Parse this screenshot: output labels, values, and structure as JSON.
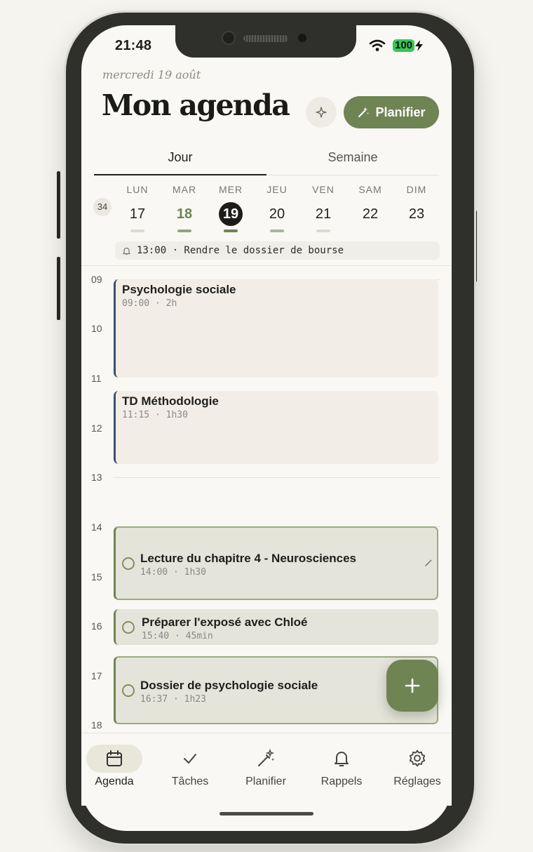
{
  "status": {
    "time": "21:48",
    "battery": "100"
  },
  "header": {
    "date": "mercredi 19 août",
    "title": "Mon agenda",
    "plan_label": "Planifier"
  },
  "tabs": [
    {
      "label": "Jour",
      "active": true
    },
    {
      "label": "Semaine",
      "active": false
    }
  ],
  "week": {
    "number": "34",
    "days": [
      {
        "name": "LUN",
        "num": "17"
      },
      {
        "name": "MAR",
        "num": "18"
      },
      {
        "name": "MER",
        "num": "19"
      },
      {
        "name": "JEU",
        "num": "20"
      },
      {
        "name": "VEN",
        "num": "21"
      },
      {
        "name": "SAM",
        "num": "22"
      },
      {
        "name": "DIM",
        "num": "23"
      }
    ]
  },
  "reminder": {
    "text": "13:00 · Rendre le dossier de bourse"
  },
  "hours": [
    "09",
    "10",
    "11",
    "12",
    "13",
    "14",
    "15",
    "16",
    "17",
    "18"
  ],
  "events": [
    {
      "title": "Psychologie sociale",
      "meta": "09:00 · 2h"
    },
    {
      "title": "TD Méthodologie",
      "meta": "11:15 · 1h30"
    },
    {
      "title": "Lecture du chapitre 4 - Neurosciences",
      "meta": "14:00 · 1h30"
    },
    {
      "title": "Préparer l'exposé avec Chloé",
      "meta": "15:40 · 45min"
    },
    {
      "title": "Dossier de psychologie sociale",
      "meta": "16:37 · 1h23"
    }
  ],
  "nav": [
    {
      "label": "Agenda",
      "icon": "calendar-icon"
    },
    {
      "label": "Tâches",
      "icon": "check-icon"
    },
    {
      "label": "Planifier",
      "icon": "magic-wand-icon"
    },
    {
      "label": "Rappels",
      "icon": "bell-icon"
    },
    {
      "label": "Réglages",
      "icon": "gear-icon"
    }
  ],
  "colors": {
    "accent": "#6e8453",
    "class_bar": "#3d5170",
    "background": "#f9f8f4"
  }
}
